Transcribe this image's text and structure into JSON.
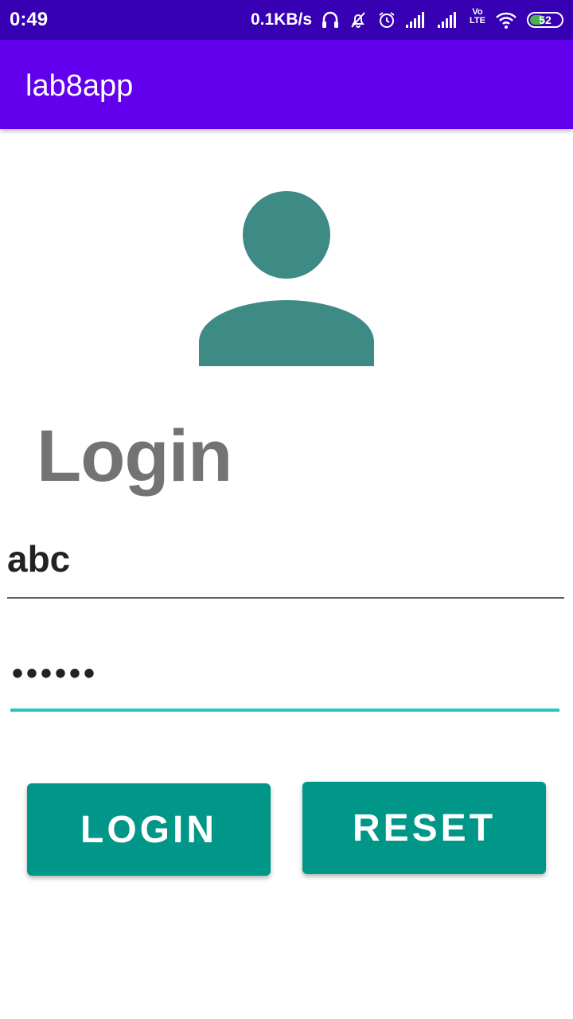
{
  "status_bar": {
    "time": "0:49",
    "net_speed": "0.1KB/s",
    "volte_top": "Vo",
    "volte_bottom": "LTE",
    "battery_level": "52",
    "background_color": "#3700b3",
    "battery_color": "#4caf50",
    "icons": [
      "headset-icon",
      "notifications-off-icon",
      "alarm-icon",
      "signal-icon",
      "signal-icon",
      "volte-icon",
      "wifi-icon",
      "battery-icon"
    ]
  },
  "app_bar": {
    "title": "lab8app",
    "color": "#6200ee"
  },
  "avatar": {
    "icon": "person-icon",
    "color": "#3d8b84"
  },
  "form": {
    "heading": "Login",
    "username_value": "abc",
    "password_value": "••••••",
    "focus_color": "#26c6b8"
  },
  "buttons": {
    "login_label": "LOGIN",
    "reset_label": "RESET",
    "color": "#009688"
  }
}
